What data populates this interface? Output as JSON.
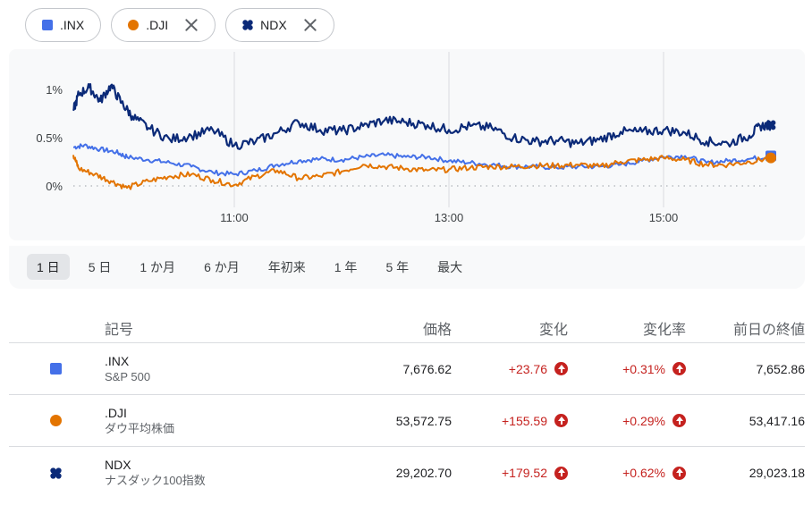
{
  "chips": [
    {
      "label": ".INX",
      "color": "#4470e8",
      "shape": "square",
      "closable": false
    },
    {
      "label": ".DJI",
      "color": "#e37400",
      "shape": "circle",
      "closable": true
    },
    {
      "label": "NDX",
      "color": "#0b2a78",
      "shape": "clover",
      "closable": true
    }
  ],
  "ranges": [
    "1 日",
    "5 日",
    "1 か月",
    "6 か月",
    "年初来",
    "1 年",
    "5 年",
    "最大"
  ],
  "active_range": "1 日",
  "table": {
    "headers": {
      "symbol": "記号",
      "price": "価格",
      "change": "変化",
      "pct": "変化率",
      "prev": "前日の終値"
    },
    "rows": [
      {
        "symbol": ".INX",
        "name": "S&P 500",
        "price": "7,676.62",
        "change": "+23.76",
        "pct": "+0.31%",
        "prev": "7,652.86",
        "color": "#4470e8",
        "shape": "square"
      },
      {
        "symbol": ".DJI",
        "name": "ダウ平均株価",
        "price": "53,572.75",
        "change": "+155.59",
        "pct": "+0.29%",
        "prev": "53,417.16",
        "color": "#e37400",
        "shape": "circle"
      },
      {
        "symbol": "NDX",
        "name": "ナスダック100指数",
        "price": "29,202.70",
        "change": "+179.52",
        "pct": "+0.62%",
        "prev": "29,023.18",
        "color": "#0b2a78",
        "shape": "clover"
      }
    ]
  },
  "chart_data": {
    "type": "line",
    "title": "",
    "xlabel": "",
    "ylabel": "",
    "x_ticks": [
      "11:00",
      "13:00",
      "15:00"
    ],
    "y_ticks": [
      "0%",
      "0.5%",
      "1%"
    ],
    "ylim": [
      -0.15,
      1.25
    ],
    "x_hours": [
      9.5,
      16.0
    ],
    "grid": "vertical at time ticks; dotted baseline at 0%",
    "series": [
      {
        "name": ".INX",
        "color": "#4470e8",
        "x": [
          9.5,
          9.6,
          9.75,
          9.9,
          10.0,
          10.2,
          10.4,
          10.6,
          10.8,
          11.0,
          11.2,
          11.4,
          11.6,
          11.8,
          12.0,
          12.2,
          12.4,
          12.6,
          12.8,
          13.0,
          13.2,
          13.4,
          13.6,
          13.8,
          14.0,
          14.2,
          14.4,
          14.6,
          14.8,
          15.0,
          15.2,
          15.4,
          15.6,
          15.8,
          16.0
        ],
        "values": [
          0.4,
          0.42,
          0.38,
          0.35,
          0.3,
          0.27,
          0.24,
          0.2,
          0.14,
          0.12,
          0.16,
          0.22,
          0.26,
          0.28,
          0.27,
          0.3,
          0.32,
          0.3,
          0.3,
          0.26,
          0.24,
          0.22,
          0.2,
          0.2,
          0.19,
          0.2,
          0.2,
          0.22,
          0.26,
          0.3,
          0.31,
          0.24,
          0.26,
          0.28,
          0.31
        ]
      },
      {
        "name": ".DJI",
        "color": "#e37400",
        "x": [
          9.5,
          9.55,
          9.7,
          9.85,
          10.0,
          10.2,
          10.4,
          10.6,
          10.8,
          11.0,
          11.2,
          11.4,
          11.6,
          11.8,
          12.0,
          12.2,
          12.4,
          12.6,
          12.8,
          13.0,
          13.2,
          13.4,
          13.6,
          13.8,
          14.0,
          14.2,
          14.4,
          14.6,
          14.8,
          15.0,
          15.2,
          15.4,
          15.6,
          15.8,
          16.0
        ],
        "values": [
          0.32,
          0.18,
          0.12,
          0.05,
          -0.02,
          0.05,
          0.1,
          0.12,
          0.06,
          0.01,
          0.1,
          0.16,
          0.08,
          0.1,
          0.15,
          0.22,
          0.2,
          0.18,
          0.16,
          0.17,
          0.19,
          0.2,
          0.2,
          0.21,
          0.21,
          0.22,
          0.2,
          0.25,
          0.27,
          0.29,
          0.27,
          0.22,
          0.22,
          0.25,
          0.29
        ]
      },
      {
        "name": "NDX",
        "color": "#0b2a78",
        "x": [
          9.5,
          9.55,
          9.65,
          9.75,
          9.85,
          9.95,
          10.05,
          10.2,
          10.4,
          10.6,
          10.8,
          11.0,
          11.2,
          11.4,
          11.6,
          11.8,
          12.0,
          12.2,
          12.4,
          12.6,
          12.8,
          13.0,
          13.2,
          13.4,
          13.6,
          13.8,
          14.0,
          14.2,
          14.4,
          14.6,
          14.8,
          15.0,
          15.2,
          15.4,
          15.6,
          15.8,
          15.9,
          16.0
        ],
        "values": [
          0.78,
          0.95,
          1.02,
          0.88,
          1.04,
          0.86,
          0.72,
          0.6,
          0.48,
          0.52,
          0.58,
          0.42,
          0.46,
          0.55,
          0.66,
          0.58,
          0.57,
          0.62,
          0.68,
          0.66,
          0.63,
          0.58,
          0.62,
          0.6,
          0.5,
          0.46,
          0.47,
          0.44,
          0.48,
          0.56,
          0.56,
          0.58,
          0.55,
          0.46,
          0.44,
          0.52,
          0.62,
          0.63
        ]
      }
    ]
  }
}
